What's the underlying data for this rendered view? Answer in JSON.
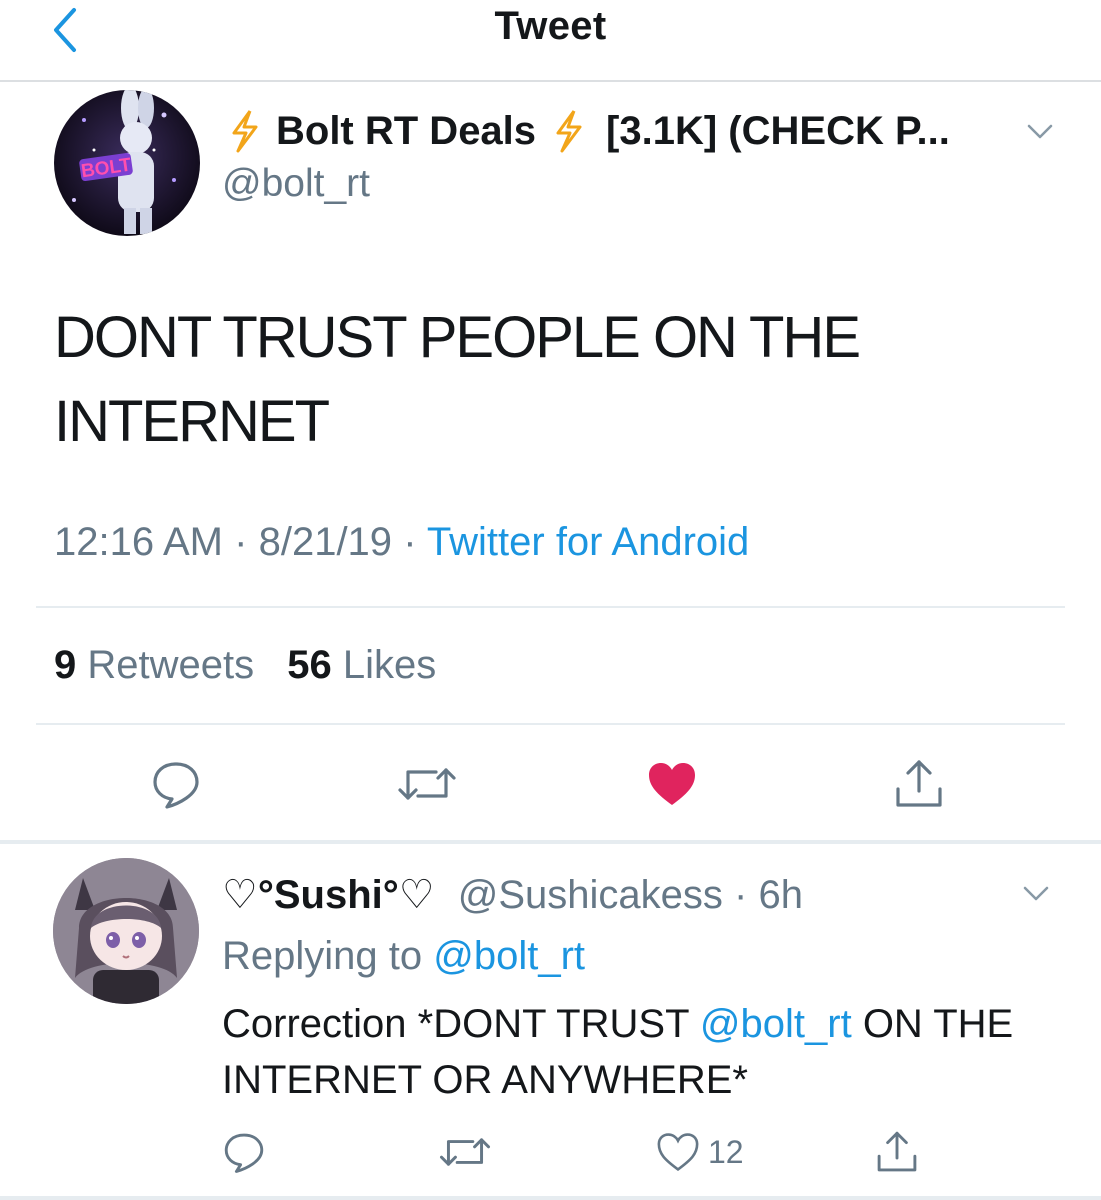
{
  "header": {
    "title": "Tweet",
    "back_icon": "chevron-left-icon"
  },
  "tweet": {
    "avatar_text": "BOLT",
    "bolt_emoji": "⚡",
    "name_main": "Bolt RT Deals",
    "name_suffix": "[3.1K] (CHECK P...",
    "handle": "@bolt_rt",
    "text": "DONT TRUST PEOPLE ON THE INTERNET",
    "time": "12:16 AM",
    "date": "8/21/19",
    "separator": "·",
    "source": "Twitter for Android",
    "retweet_count": "9",
    "retweet_label": "Retweets",
    "like_count": "56",
    "like_label": "Likes"
  },
  "reply": {
    "name": "♡°Sushi°♡",
    "handle": "@Sushicakess",
    "separator": "·",
    "age": "6h",
    "replying_prefix": "Replying to",
    "replying_handle": "@bolt_rt",
    "text_part1": "Correction *DONT TRUST",
    "text_mention": "@bolt_rt",
    "text_part2": "ON THE INTERNET OR ANYWHERE*",
    "like_count": "12"
  },
  "colors": {
    "accent": "#1b95e0",
    "muted": "#657786",
    "like_active": "#e0245e",
    "text": "#14171a"
  }
}
